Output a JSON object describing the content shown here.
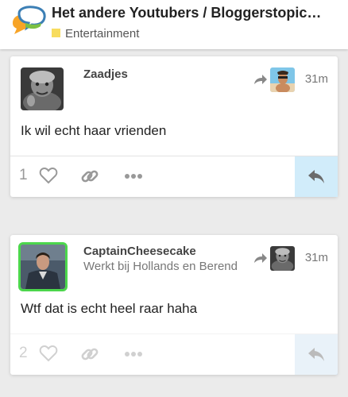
{
  "topic": {
    "title": "Het andere Youtubers / Bloggerstopic ...",
    "category": "Entertainment",
    "category_color": "#f7dc5e"
  },
  "posts": [
    {
      "username": "Zaadjes",
      "user_title": "",
      "time": "31m",
      "content": "Ik wil echt haar vrienden",
      "likes": "1",
      "avatar_icon": "stone-statue-avatar",
      "reply_to_avatar_icon": "beach-person-avatar"
    },
    {
      "username": "CaptainCheesecake",
      "user_title": "Werkt bij Hollands en Berend",
      "time": "31m",
      "content": "Wtf dat is echt heel raar haha",
      "likes": "2",
      "avatar_icon": "man-in-coat-avatar",
      "reply_to_avatar_icon": "stone-statue-avatar"
    }
  ],
  "colors": {
    "accent_green": "#4cd64c",
    "reply_highlight": "#d1ecfa",
    "icon_gray": "#999999"
  }
}
